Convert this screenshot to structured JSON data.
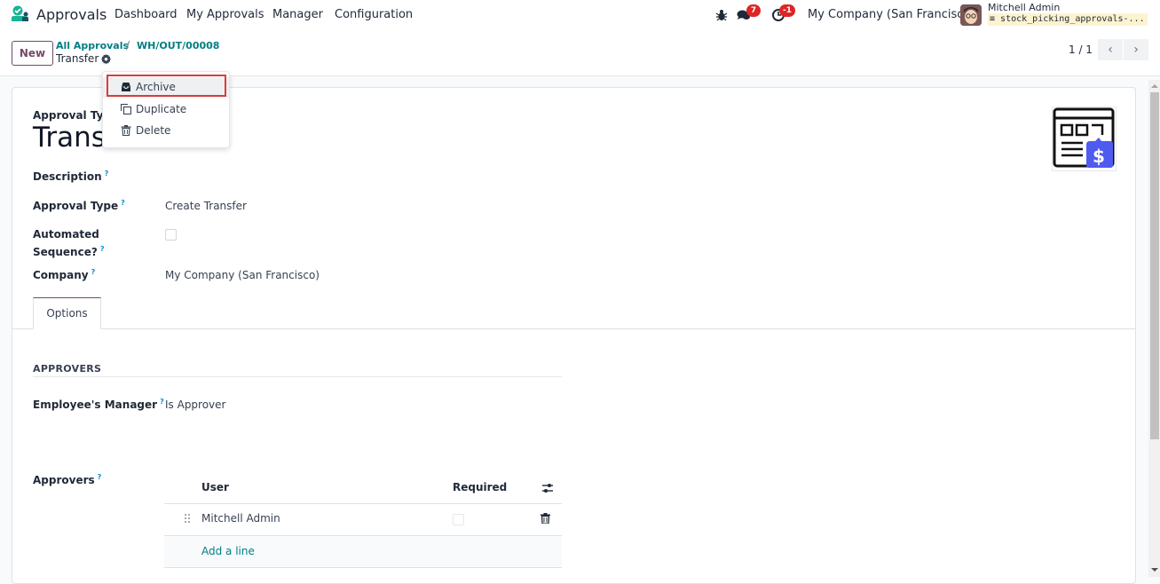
{
  "navbar": {
    "app_name": "Approvals",
    "menu": [
      "Dashboard",
      "My Approvals",
      "Manager",
      "Configuration"
    ],
    "messages_badge": "7",
    "activities_badge": "-1",
    "company": "My Company (San Francisco)",
    "user_name": "Mitchell Admin",
    "database": "stock_picking_approvals-..."
  },
  "control_panel": {
    "new_label": "New",
    "breadcrumbs": [
      "All Approvals",
      "WH/OUT/00008"
    ],
    "current": "Transfer",
    "pager_value": "1 / 1"
  },
  "action_menu": {
    "items": [
      {
        "label": "Archive",
        "icon": "archive-icon"
      },
      {
        "label": "Duplicate",
        "icon": "duplicate-icon"
      },
      {
        "label": "Delete",
        "icon": "trash-icon"
      }
    ]
  },
  "form": {
    "approval_type_label": "Approval Type",
    "title": "Transfer",
    "description_label": "Description",
    "approval_type_field_label": "Approval Type",
    "approval_type_value": "Create Transfer",
    "automated_sequence_label_1": "Automated",
    "automated_sequence_label_2": "Sequence?",
    "automated_sequence_checked": false,
    "company_label": "Company",
    "company_value": "My Company (San Francisco)",
    "help_mark": "?"
  },
  "tabs": [
    {
      "label": "Options",
      "active": true
    }
  ],
  "options": {
    "section_title": "APPROVERS",
    "employee_manager_label": "Employee's Manager",
    "employee_manager_value": "Is Approver",
    "approvers_label": "Approvers",
    "table": {
      "columns": [
        "User",
        "Required"
      ],
      "rows": [
        {
          "user": "Mitchell Admin",
          "required": false
        }
      ],
      "add_line": "Add a line"
    }
  },
  "scrollbar": {
    "thumb_start_fraction": 0.0,
    "visible_fraction": 0.74
  },
  "colors": {
    "brand": "#714b67",
    "link": "#017e84",
    "badge": "#dc2626",
    "help": "#0d8fc4"
  }
}
